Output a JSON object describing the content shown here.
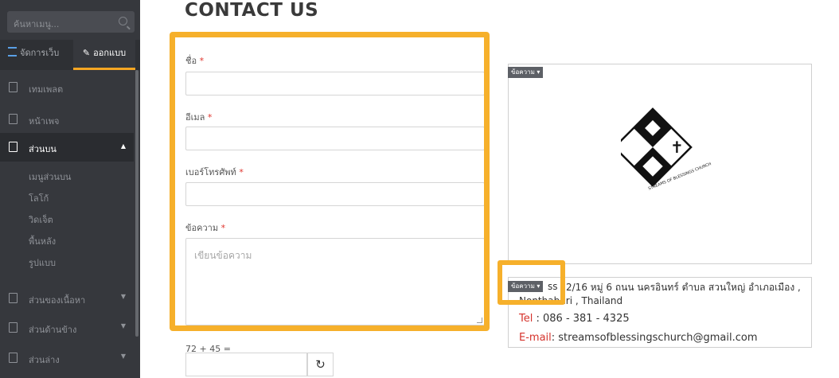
{
  "sidebar": {
    "search_placeholder": "ค้นหาเมนู...",
    "tabs": [
      {
        "label": "จัดการเว็บ"
      },
      {
        "label": "ออกแบบ"
      }
    ],
    "items": [
      {
        "label": "เทมเพลต"
      },
      {
        "label": "หน้าเพจ"
      },
      {
        "label": "ส่วนบน"
      },
      {
        "label": "ส่วนของเนื้อหา"
      },
      {
        "label": "ส่วนด้านข้าง"
      },
      {
        "label": "ส่วนล่าง"
      }
    ],
    "subitems": [
      "เมนูส่วนบน",
      "โลโก้",
      "วิดเจ็ต",
      "พื้นหลัง",
      "รูปแบบ"
    ]
  },
  "page": {
    "title": "CONTACT US"
  },
  "form": {
    "name_label": "ชื่อ",
    "email_label": "อีเมล",
    "phone_label": "เบอร์โทรศัพท์",
    "message_label": "ข้อความ",
    "message_placeholder": "เขียนข้อความ",
    "required_mark": "*",
    "captcha_question": "72 + 45 ="
  },
  "widgets": {
    "badge_label": "ข้อความ",
    "logo_text": "STREAMS OF BLESSINGS CHURCH",
    "address_line1": "2/16 หมู่ 6 ถนน นครอินทร์ ตำบล สวนใหญ่ อำเภอเมือง ,",
    "address_partial_1": "ss",
    "address_line2": "Nonthaburi , Thailand",
    "tel_label": "Tel",
    "tel_value": ": 086 - 381 - 4325",
    "email_label": "E-mail",
    "email_value": ":  streamsofblessingschurch@gmail.com"
  },
  "colors": {
    "highlight": "#f6b02b",
    "sidebar_bg": "#36383d",
    "required": "#e0342c"
  }
}
